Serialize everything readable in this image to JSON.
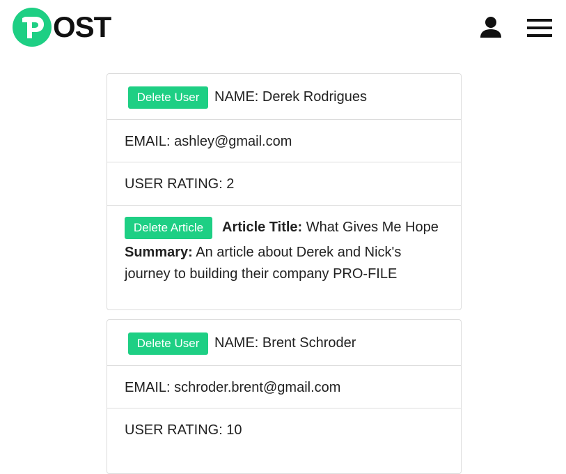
{
  "header": {
    "logo_text": "OST",
    "icons": [
      "post-logo-icon",
      "user-icon",
      "menu-icon"
    ],
    "brand_color": "#1ecf84"
  },
  "users": [
    {
      "delete_label": "Delete User",
      "name": "NAME: Derek Rodrigues",
      "email": "EMAIL: ashley@gmail.com",
      "rating": "USER RATING: 2",
      "article": {
        "delete_label": "Delete Article",
        "title_label": "Article Title:",
        "title": " What Gives Me Hope",
        "summary_label": "Summary:",
        "summary": " An article about Derek and Nick's journey to building their company PRO-FILE"
      }
    },
    {
      "delete_label": "Delete User",
      "name": "NAME: Brent Schroder",
      "email": "EMAIL: schroder.brent@gmail.com",
      "rating": "USER RATING: 10"
    }
  ]
}
